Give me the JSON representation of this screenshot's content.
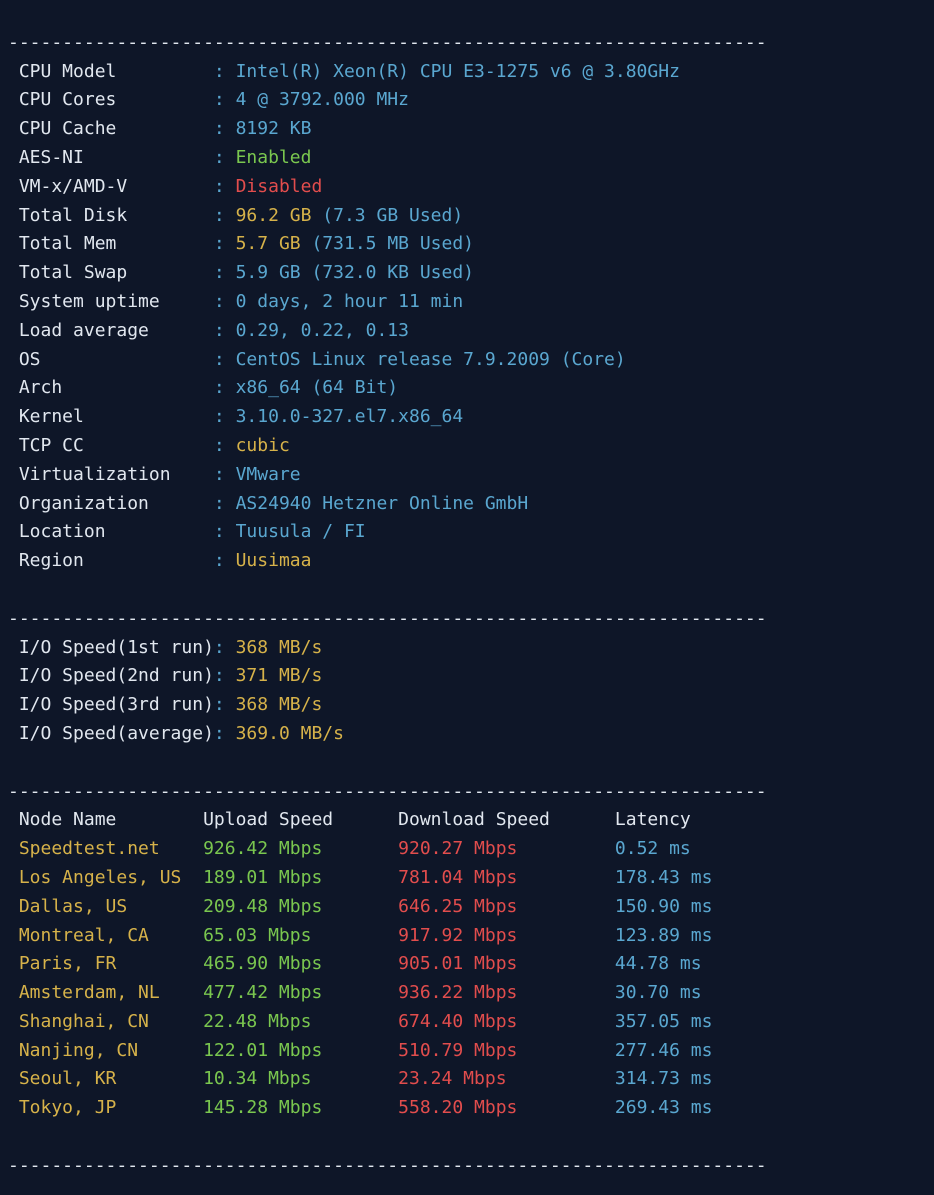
{
  "hr_top": "----------------------------------------------------------------------",
  "hr": "----------------------------------------------------------------------",
  "sysinfo": [
    {
      "label": "CPU Model",
      "parts": [
        {
          "cls": "cyan",
          "text": "Intel(R) Xeon(R) CPU E3-1275 v6 @ 3.80GHz"
        }
      ]
    },
    {
      "label": "CPU Cores",
      "parts": [
        {
          "cls": "cyan",
          "text": "4 @ 3792.000 MHz"
        }
      ]
    },
    {
      "label": "CPU Cache",
      "parts": [
        {
          "cls": "cyan",
          "text": "8192 KB"
        }
      ]
    },
    {
      "label": "AES-NI",
      "parts": [
        {
          "cls": "green",
          "text": "Enabled"
        }
      ]
    },
    {
      "label": "VM-x/AMD-V",
      "parts": [
        {
          "cls": "red",
          "text": "Disabled"
        }
      ]
    },
    {
      "label": "Total Disk",
      "parts": [
        {
          "cls": "yellow",
          "text": "96.2 "
        },
        {
          "cls": "yellow",
          "text": "GB "
        },
        {
          "cls": "cyan",
          "text": "(7.3 GB Used)"
        }
      ]
    },
    {
      "label": "Total Mem",
      "parts": [
        {
          "cls": "yellow",
          "text": "5.7 "
        },
        {
          "cls": "yellow",
          "text": "GB "
        },
        {
          "cls": "cyan",
          "text": "(731.5 MB Used)"
        }
      ]
    },
    {
      "label": "Total Swap",
      "parts": [
        {
          "cls": "cyan",
          "text": "5.9 GB (732.0 KB Used)"
        }
      ]
    },
    {
      "label": "System uptime",
      "parts": [
        {
          "cls": "cyan",
          "text": "0 days, 2 hour 11 min"
        }
      ]
    },
    {
      "label": "Load average",
      "parts": [
        {
          "cls": "cyan",
          "text": "0.29, 0.22, 0.13"
        }
      ]
    },
    {
      "label": "OS",
      "parts": [
        {
          "cls": "cyan",
          "text": "CentOS Linux release 7.9.2009 (Core)"
        }
      ]
    },
    {
      "label": "Arch",
      "parts": [
        {
          "cls": "cyan",
          "text": "x86_64 (64 Bit)"
        }
      ]
    },
    {
      "label": "Kernel",
      "parts": [
        {
          "cls": "cyan",
          "text": "3.10.0-327.el7.x86_64"
        }
      ]
    },
    {
      "label": "TCP CC",
      "parts": [
        {
          "cls": "yellow",
          "text": "cubic"
        }
      ]
    },
    {
      "label": "Virtualization",
      "parts": [
        {
          "cls": "cyan",
          "text": "VMware"
        }
      ]
    },
    {
      "label": "Organization",
      "parts": [
        {
          "cls": "cyan",
          "text": "AS24940 Hetzner Online GmbH"
        }
      ]
    },
    {
      "label": "Location",
      "parts": [
        {
          "cls": "cyan",
          "text": "Tuusula / FI"
        }
      ]
    },
    {
      "label": "Region",
      "parts": [
        {
          "cls": "yellow",
          "text": "Uusimaa"
        }
      ]
    }
  ],
  "iospeed": [
    {
      "label": "I/O Speed(1st run)",
      "value": "368 MB/s"
    },
    {
      "label": "I/O Speed(2nd run)",
      "value": "371 MB/s"
    },
    {
      "label": "I/O Speed(3rd run)",
      "value": "368 MB/s"
    },
    {
      "label": "I/O Speed(average)",
      "value": "369.0 MB/s"
    }
  ],
  "speedtest": {
    "headers": {
      "node": "Node Name",
      "upload": "Upload Speed",
      "download": "Download Speed",
      "latency": "Latency"
    },
    "col_widths": {
      "node": 17,
      "upload": 18,
      "download": 20,
      "latency": 12
    },
    "rows": [
      {
        "node": "Speedtest.net",
        "upload": "926.42 Mbps",
        "download": "920.27 Mbps",
        "latency": "0.52 ms"
      },
      {
        "node": "Los Angeles, US",
        "upload": "189.01 Mbps",
        "download": "781.04 Mbps",
        "latency": "178.43 ms"
      },
      {
        "node": "Dallas, US",
        "upload": "209.48 Mbps",
        "download": "646.25 Mbps",
        "latency": "150.90 ms"
      },
      {
        "node": "Montreal, CA",
        "upload": "65.03 Mbps",
        "download": "917.92 Mbps",
        "latency": "123.89 ms"
      },
      {
        "node": "Paris, FR",
        "upload": "465.90 Mbps",
        "download": "905.01 Mbps",
        "latency": "44.78 ms"
      },
      {
        "node": "Amsterdam, NL",
        "upload": "477.42 Mbps",
        "download": "936.22 Mbps",
        "latency": "30.70 ms"
      },
      {
        "node": "Shanghai, CN",
        "upload": "22.48 Mbps",
        "download": "674.40 Mbps",
        "latency": "357.05 ms"
      },
      {
        "node": "Nanjing, CN",
        "upload": "122.01 Mbps",
        "download": "510.79 Mbps",
        "latency": "277.46 ms"
      },
      {
        "node": "Seoul, KR",
        "upload": "10.34 Mbps",
        "download": "23.24 Mbps",
        "latency": "314.73 ms"
      },
      {
        "node": "Tokyo, JP",
        "upload": "145.28 Mbps",
        "download": "558.20 Mbps",
        "latency": "269.43 ms"
      }
    ]
  }
}
